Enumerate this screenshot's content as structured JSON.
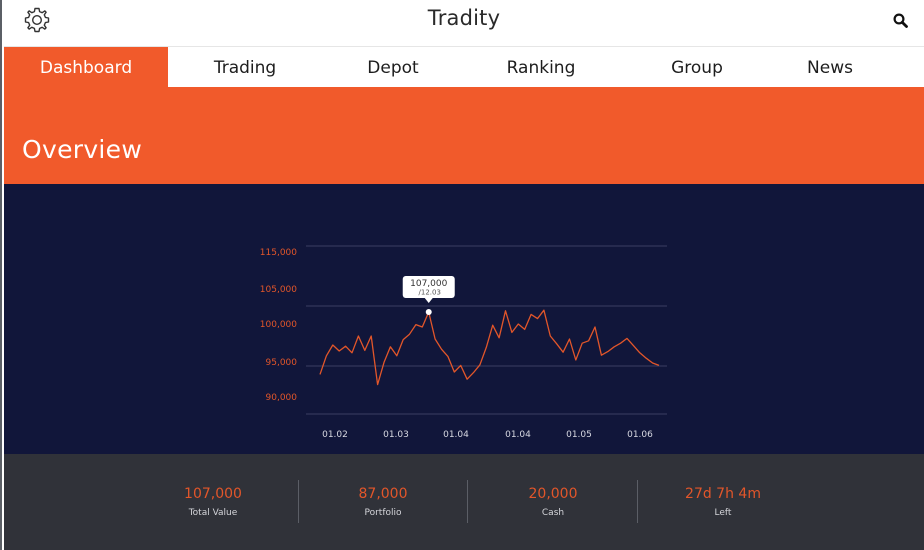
{
  "app": {
    "title": "Tradity"
  },
  "icons": {
    "settings": "gear-icon",
    "search": "search-icon"
  },
  "tabs": [
    {
      "label": "Dashboard",
      "active": true
    },
    {
      "label": "Trading",
      "active": false
    },
    {
      "label": "Depot",
      "active": false
    },
    {
      "label": "Ranking",
      "active": false
    },
    {
      "label": "Group",
      "active": false
    },
    {
      "label": "News",
      "active": false
    }
  ],
  "page": {
    "title": "Overview"
  },
  "colors": {
    "accent": "#f15a2b",
    "chart_bg": "#11163a",
    "stats_bg": "#303239",
    "line": "#e2562a"
  },
  "chart_data": {
    "type": "line",
    "x_tick_labels": [
      "01.02",
      "01.03",
      "01.04",
      "01.04",
      "01.05",
      "01.06"
    ],
    "y_tick_labels": [
      "115,000",
      "105,000",
      "100,000",
      "95,000",
      "90,000"
    ],
    "y_gridlines": [
      115000,
      105000,
      95000
    ],
    "ylim": [
      87000,
      117000
    ],
    "tooltip": {
      "value": "107,000",
      "date": "/12.03"
    },
    "series": [
      {
        "values": [
          93600,
          96700,
          98500,
          97500,
          98300,
          97200,
          100000,
          97600,
          100000,
          91900,
          95600,
          98200,
          96700,
          99400,
          100300,
          101900,
          101500,
          104000,
          99500,
          97800,
          96600,
          94000,
          95100,
          92800,
          93900,
          95200,
          98100,
          101800,
          99700,
          104200,
          100600,
          102000,
          101100,
          103600,
          102900,
          104300,
          100000,
          98700,
          97300,
          99500,
          96000,
          98800,
          99200,
          101500,
          96800,
          97400,
          98200,
          98800,
          99600,
          98400,
          97200,
          96300,
          95500,
          95100
        ]
      }
    ]
  },
  "stats": [
    {
      "value": "107,000",
      "label": "Total Value"
    },
    {
      "value": "87,000",
      "label": "Portfolio"
    },
    {
      "value": "20,000",
      "label": "Cash"
    },
    {
      "value": "27d 7h 4m",
      "label": "Left"
    }
  ]
}
